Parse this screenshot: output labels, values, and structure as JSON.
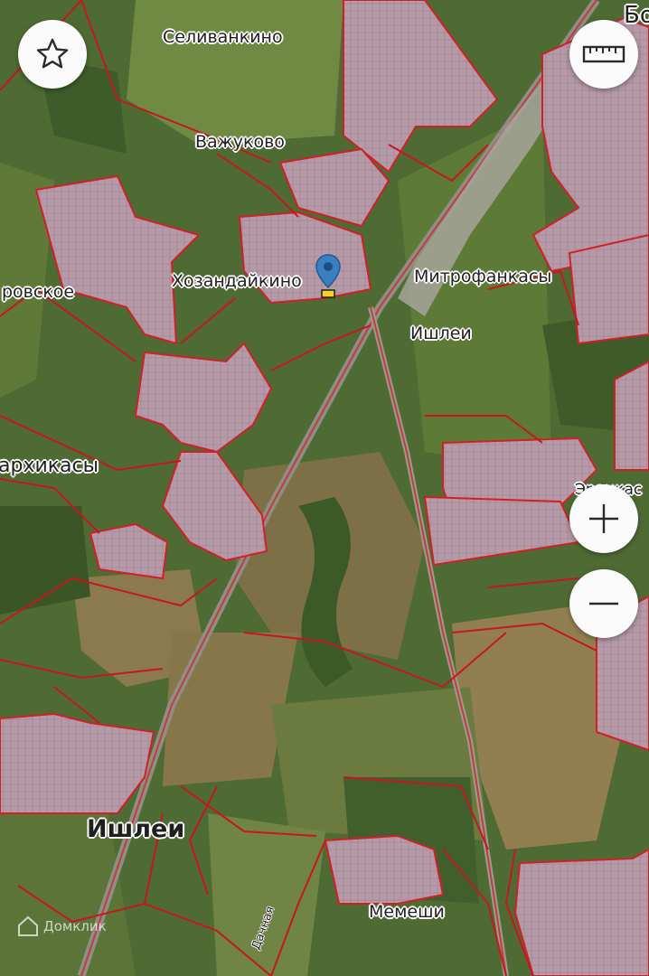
{
  "map": {
    "place_labels": [
      {
        "id": "selivankino",
        "text": "Селиванкино"
      },
      {
        "id": "vazhukovo",
        "text": "Важуково"
      },
      {
        "id": "khozandaikino",
        "text": "Хозандайкино"
      },
      {
        "id": "mitrofankasy",
        "text": "Митрофанкасы"
      },
      {
        "id": "ishlei-station",
        "text": "Ишлеи"
      },
      {
        "id": "rovskoe",
        "text": "ровское"
      },
      {
        "id": "arkhikasy",
        "text": "архикасы"
      },
      {
        "id": "ishlei-town",
        "text": "Ишлеи"
      },
      {
        "id": "memeshi",
        "text": "Мемеши"
      },
      {
        "id": "top-right-partial",
        "text": "Бо"
      },
      {
        "id": "right-partial",
        "text": "Эранкас"
      }
    ],
    "road_label": "Дачная",
    "marker": {
      "icon": "location-pin-icon",
      "color": "#3a7fc1"
    }
  },
  "controls": {
    "favorite": {
      "icon": "star-icon"
    },
    "ruler": {
      "icon": "ruler-icon"
    },
    "zoom_in": {
      "icon": "plus-icon"
    },
    "zoom_out": {
      "icon": "minus-icon"
    }
  },
  "watermark": {
    "text": "Домклик",
    "icon": "domclick-logo-icon"
  },
  "colors": {
    "parcel_fill": "#b39aa6",
    "parcel_border": "#d11f2a",
    "field": "#8a7a4e",
    "forest": "#3c5a28"
  }
}
